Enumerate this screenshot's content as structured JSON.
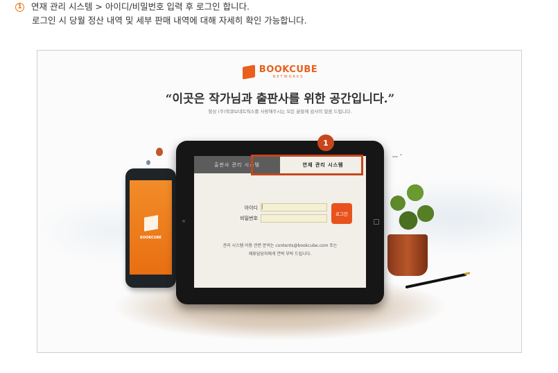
{
  "instructions": {
    "step_number": "1",
    "line1": "연재 관리 시스템 > 아이디/비밀번호 입력 후 로그인 합니다.",
    "line2": "로그인 시 당월 정산 내역 및 세부 판매 내역에 대해 자세히 확인 가능합니다."
  },
  "hero": {
    "brand": "BOOKCUBE",
    "brand_sub": "NETWORKS",
    "headline": "“이곳은 작가님과 출판사를 위한 공간입니다.”",
    "subline": "항상 (주)북큐브네트웍스를 사랑해주시는 모든 분들께 감사의 말씀 드립니다."
  },
  "phone": {
    "app_label": "BOOKCUBE"
  },
  "login": {
    "tabs": [
      "출판사 관리 시스템",
      "연재 관리 시스템"
    ],
    "active_tab": 1,
    "callout_number": "1",
    "id_label": "아이디",
    "id_value": "|",
    "password_label": "비밀번호",
    "password_value": "",
    "login_button": "로그인",
    "help_line1": "관리 시스템 이용 관련 문의는 contents@bookcube.com 또는",
    "help_line2": "제휴담당자에게 연락 부탁 드립니다."
  },
  "colors": {
    "accent": "#c8461b",
    "brand": "#e8601c",
    "input_bg": "#f5f0d2"
  }
}
